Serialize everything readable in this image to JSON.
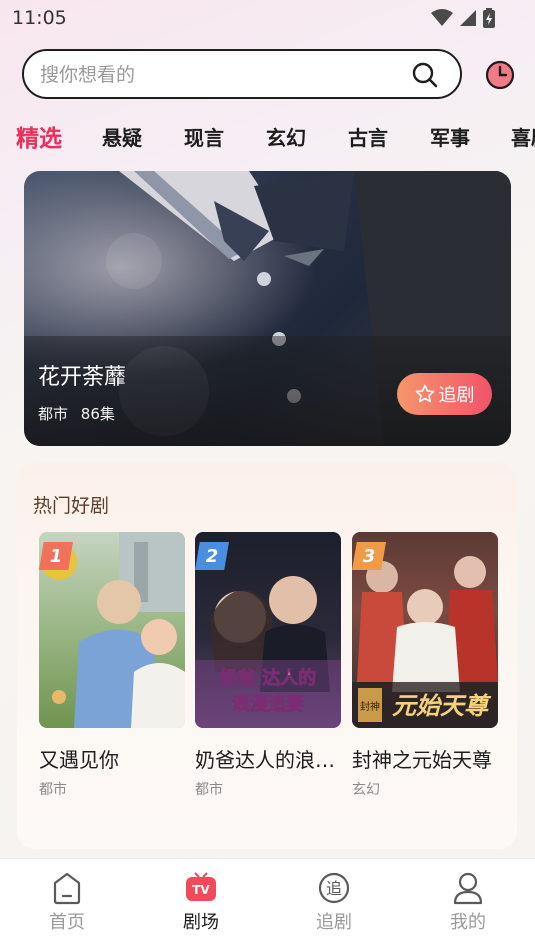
{
  "status_bar": {
    "time": "11:05"
  },
  "search": {
    "placeholder": "搜你想看的"
  },
  "category_tabs": [
    {
      "label": "精选",
      "active": true
    },
    {
      "label": "悬疑"
    },
    {
      "label": "现言"
    },
    {
      "label": "玄幻"
    },
    {
      "label": "古言"
    },
    {
      "label": "军事"
    },
    {
      "label": "喜剧"
    }
  ],
  "banner": {
    "title": "花开荼蘼",
    "genre": "都市",
    "episodes": "86集",
    "follow_label": "追剧"
  },
  "hot_section": {
    "title": "热门好剧",
    "dramas": [
      {
        "rank": "1",
        "name": "又遇见你",
        "genre": "都市",
        "badge_color": "#f0725a"
      },
      {
        "rank": "2",
        "name": "奶爸达人的浪漫追妻",
        "genre": "都市",
        "badge_color": "#4a8ee0"
      },
      {
        "rank": "3",
        "name": "封神之元始天尊",
        "genre": "玄幻",
        "badge_color": "#f09b47"
      }
    ],
    "poster_texts": {
      "poster_2_caption_line1": "奶爸 达人的",
      "poster_2_caption_line2": "浪漫追妻",
      "poster_3_caption": "元始天尊",
      "poster_3_seal": "封神"
    }
  },
  "bottom_nav": [
    {
      "label": "首页",
      "icon": "home-icon"
    },
    {
      "label": "剧场",
      "icon": "tv-icon",
      "active": true,
      "icon_text": "TV"
    },
    {
      "label": "追剧",
      "icon": "follow-icon",
      "icon_text": "追"
    },
    {
      "label": "我的",
      "icon": "profile-icon"
    }
  ],
  "colors": {
    "accent": "#ee2d5b",
    "follow_button_start": "#f5966b",
    "follow_button_end": "#f2536a"
  }
}
